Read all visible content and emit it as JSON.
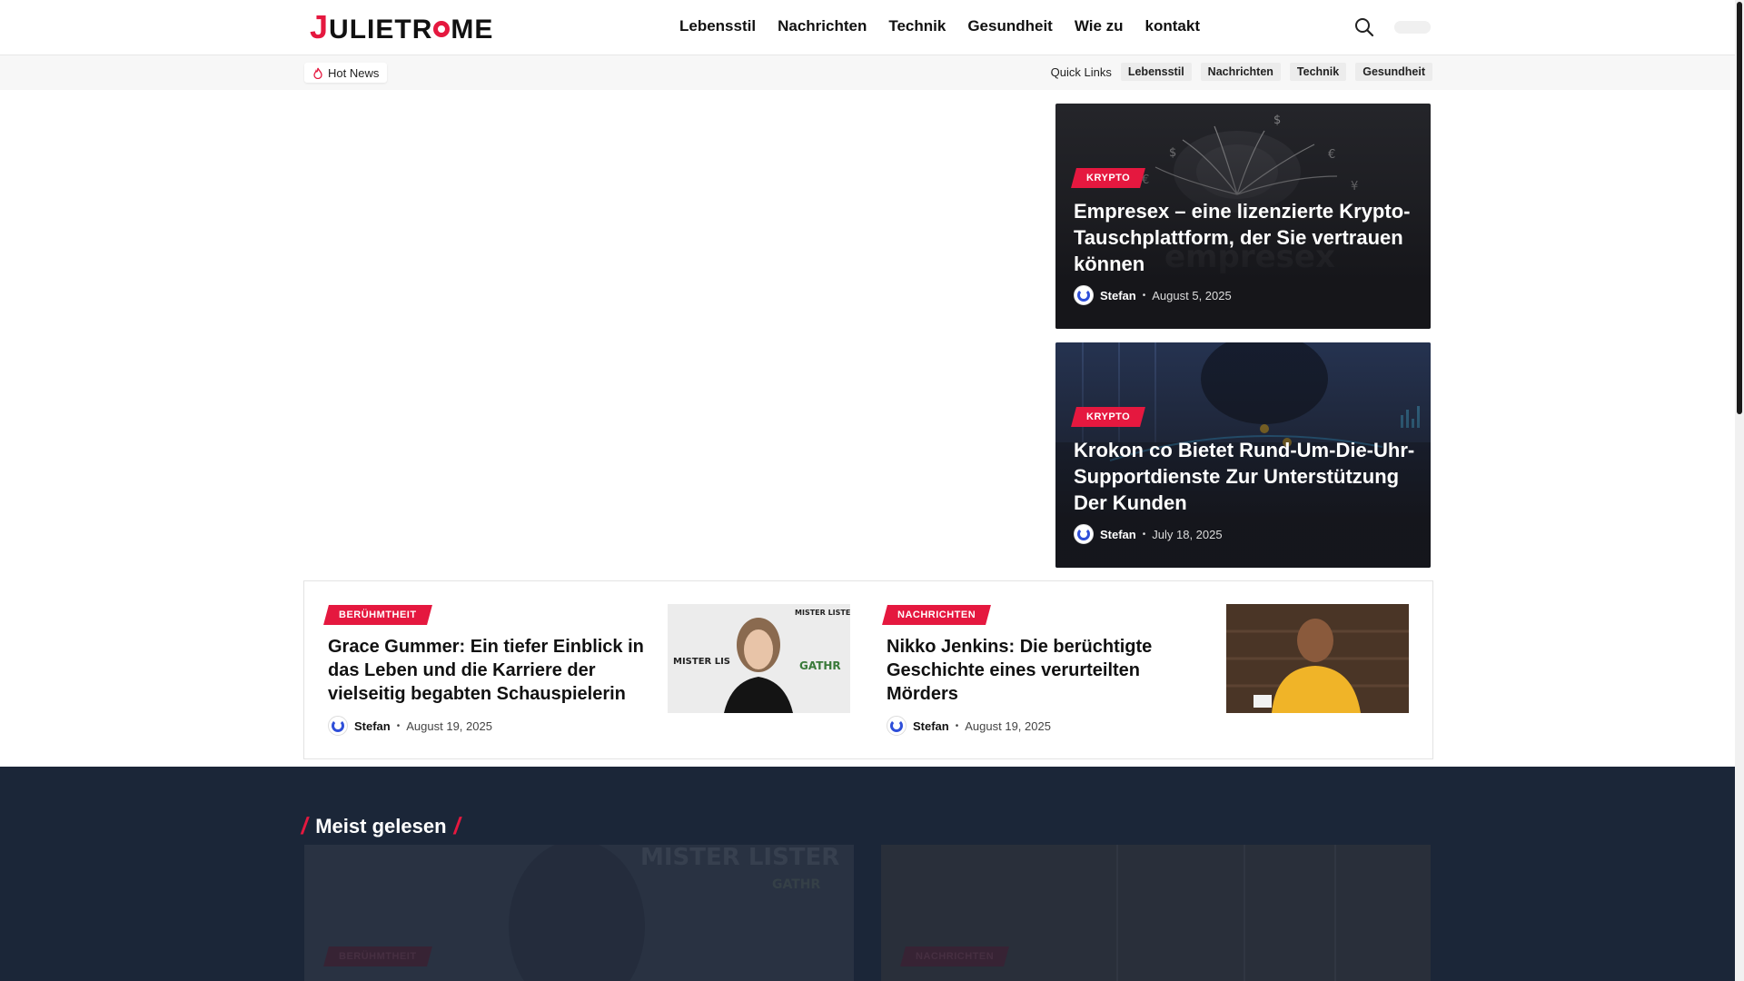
{
  "site": {
    "logo": {
      "first": "J",
      "mid1": "ULIETR",
      "ring": "O",
      "mid2": "ME"
    },
    "nav": [
      "Lebensstil",
      "Nachrichten",
      "Technik",
      "Gesundheit",
      "Wie zu",
      "kontakt"
    ]
  },
  "subbar": {
    "hot_news": "Hot News",
    "quick_links_label": "Quick Links",
    "quick_links": [
      "Lebensstil",
      "Nachrichten",
      "Technik",
      "Gesundheit"
    ]
  },
  "hero": [
    {
      "category": "KRYPTO",
      "title": "Empresex – eine lizenzierte Krypto-Tauschplattform, der Sie vertrauen können",
      "author": "Stefan",
      "date": "August 5, 2025",
      "bg_color": "#2a2b30"
    },
    {
      "category": "KRYPTO",
      "title": "Krokon co Bietet Rund-Um-Die-Uhr-Supportdienste Zur Unterstützung Der Kunden",
      "author": "Stefan",
      "date": "July 18, 2025",
      "bg_color": "#1d2a45"
    }
  ],
  "small_posts": [
    {
      "category": "BERÜHMTHEIT",
      "title": "Grace Gummer: Ein tiefer Einblick in das Leben und die Karriere der vielseitig begabten Schauspielerin",
      "author": "Stefan",
      "date": "August 19, 2025"
    },
    {
      "category": "NACHRICHTEN",
      "title": "Nikko Jenkins: Die berüchtigte Geschichte eines verurteilten Mörders",
      "author": "Stefan",
      "date": "August 19, 2025"
    }
  ],
  "most_read": {
    "title": "Meist gelesen",
    "cards": [
      {
        "category": "BERÜHMTHEIT"
      },
      {
        "category": "NACHRICHTEN"
      }
    ]
  },
  "colors": {
    "accent": "#e5183f",
    "dark_section": "#1b2638",
    "avatar_ring": "#2f4fd9"
  }
}
